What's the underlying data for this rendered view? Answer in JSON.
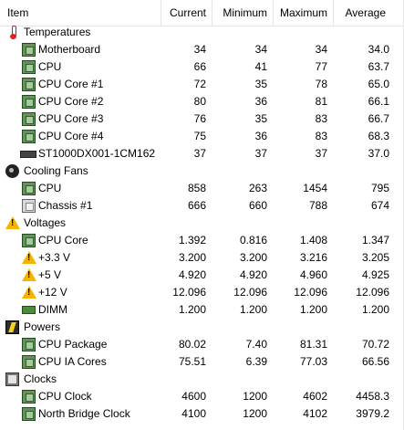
{
  "columns": {
    "item": "Item",
    "current": "Current",
    "minimum": "Minimum",
    "maximum": "Maximum",
    "average": "Average"
  },
  "groups": {
    "temperatures": "Temperatures",
    "cooling_fans": "Cooling Fans",
    "voltages": "Voltages",
    "powers": "Powers",
    "clocks": "Clocks"
  },
  "rows": {
    "motherboard": {
      "label": "Motherboard",
      "current": "34",
      "minimum": "34",
      "maximum": "34",
      "average": "34.0"
    },
    "cpu_temp": {
      "label": "CPU",
      "current": "66",
      "minimum": "41",
      "maximum": "77",
      "average": "63.7"
    },
    "core1": {
      "label": "CPU Core #1",
      "current": "72",
      "minimum": "35",
      "maximum": "78",
      "average": "65.0"
    },
    "core2": {
      "label": "CPU Core #2",
      "current": "80",
      "minimum": "36",
      "maximum": "81",
      "average": "66.1"
    },
    "core3": {
      "label": "CPU Core #3",
      "current": "76",
      "minimum": "35",
      "maximum": "83",
      "average": "66.7"
    },
    "core4": {
      "label": "CPU Core #4",
      "current": "75",
      "minimum": "36",
      "maximum": "83",
      "average": "68.3"
    },
    "hdd": {
      "label": "ST1000DX001-1CM162",
      "current": "37",
      "minimum": "37",
      "maximum": "37",
      "average": "37.0"
    },
    "fan_cpu": {
      "label": "CPU",
      "current": "858",
      "minimum": "263",
      "maximum": "1454",
      "average": "795"
    },
    "fan_chassis": {
      "label": "Chassis #1",
      "current": "666",
      "minimum": "660",
      "maximum": "788",
      "average": "674"
    },
    "cpu_core_v": {
      "label": "CPU Core",
      "current": "1.392",
      "minimum": "0.816",
      "maximum": "1.408",
      "average": "1.347"
    },
    "v33": {
      "label": "+3.3 V",
      "current": "3.200",
      "minimum": "3.200",
      "maximum": "3.216",
      "average": "3.205"
    },
    "v5": {
      "label": "+5 V",
      "current": "4.920",
      "minimum": "4.920",
      "maximum": "4.960",
      "average": "4.925"
    },
    "v12": {
      "label": "+12 V",
      "current": "12.096",
      "minimum": "12.096",
      "maximum": "12.096",
      "average": "12.096"
    },
    "dimm": {
      "label": "DIMM",
      "current": "1.200",
      "minimum": "1.200",
      "maximum": "1.200",
      "average": "1.200"
    },
    "cpu_package": {
      "label": "CPU Package",
      "current": "80.02",
      "minimum": "7.40",
      "maximum": "81.31",
      "average": "70.72"
    },
    "cpu_ia": {
      "label": "CPU IA Cores",
      "current": "75.51",
      "minimum": "6.39",
      "maximum": "77.03",
      "average": "66.56"
    },
    "cpu_clock": {
      "label": "CPU Clock",
      "current": "4600",
      "minimum": "1200",
      "maximum": "4602",
      "average": "4458.3"
    },
    "nb_clock": {
      "label": "North Bridge Clock",
      "current": "4100",
      "minimum": "1200",
      "maximum": "4102",
      "average": "3979.2"
    }
  },
  "icons": {
    "temperatures": "thermometer-icon",
    "cooling_fans": "fan-icon",
    "voltages": "warning-icon",
    "powers": "power-icon",
    "clocks": "clock-icon",
    "sensor": "chip-icon",
    "hdd": "hard-drive-icon",
    "dimm": "memory-module-icon"
  }
}
